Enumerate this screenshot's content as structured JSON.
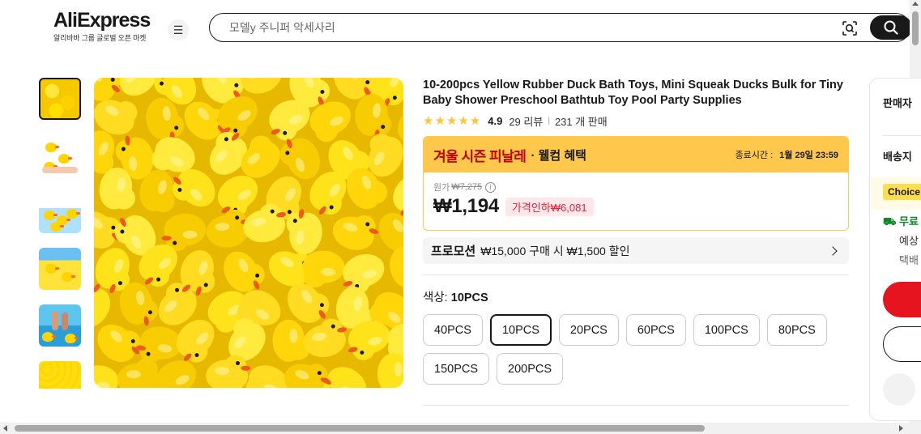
{
  "header": {
    "logo_text": "AliExpress",
    "logo_subtitle": "알리바바 그룹 글로벌 오픈 마켓",
    "menu_icon": "hamburger-icon",
    "search_placeholder": "모델y 주니퍼 악세사리",
    "camera_icon": "camera-search-icon",
    "search_icon": "search-icon"
  },
  "gallery": {
    "thumbnail_count": 6,
    "active_index": 0
  },
  "product": {
    "title": "10-200pcs Yellow Rubber Duck Bath Toys, Mini Squeak Ducks Bulk for Tiny Baby Shower Preschool Bathtub Toy Pool Party Supplies",
    "stars": "★★★★★",
    "rating": "4.9",
    "reviews": "29 리뷰",
    "separator": "|",
    "sold": "231 개 판매"
  },
  "sale": {
    "title": "겨울 시즌 피날레",
    "subtitle": "· 웰컴 혜택",
    "end_label": "종료시간 :",
    "end_time": "1월 29일 23:59",
    "original_label": "원가",
    "original_price": "₩7,275",
    "info_icon": "i",
    "price": "₩1,194",
    "discount": "가격인하₩6,081"
  },
  "promotion": {
    "label": "프로모션",
    "text": "₩15,000 구매 시 ₩1,500 할인"
  },
  "color": {
    "label": "색상: ",
    "selected": "10PCS",
    "options": [
      "40PCS",
      "10PCS",
      "20PCS",
      "60PCS",
      "100PCS",
      "80PCS",
      "150PCS",
      "200PCS"
    ],
    "selected_index": 1
  },
  "right_panel": {
    "seller": "판매자",
    "shipping": "배송지",
    "choice": "Choice",
    "free": "무료",
    "line1": "예상",
    "line2": "택배"
  },
  "colors": {
    "accent_red": "#e5141f",
    "sale_yellow": "#fdc84c",
    "star": "#fdc43c",
    "discount_text": "#e0243c"
  }
}
